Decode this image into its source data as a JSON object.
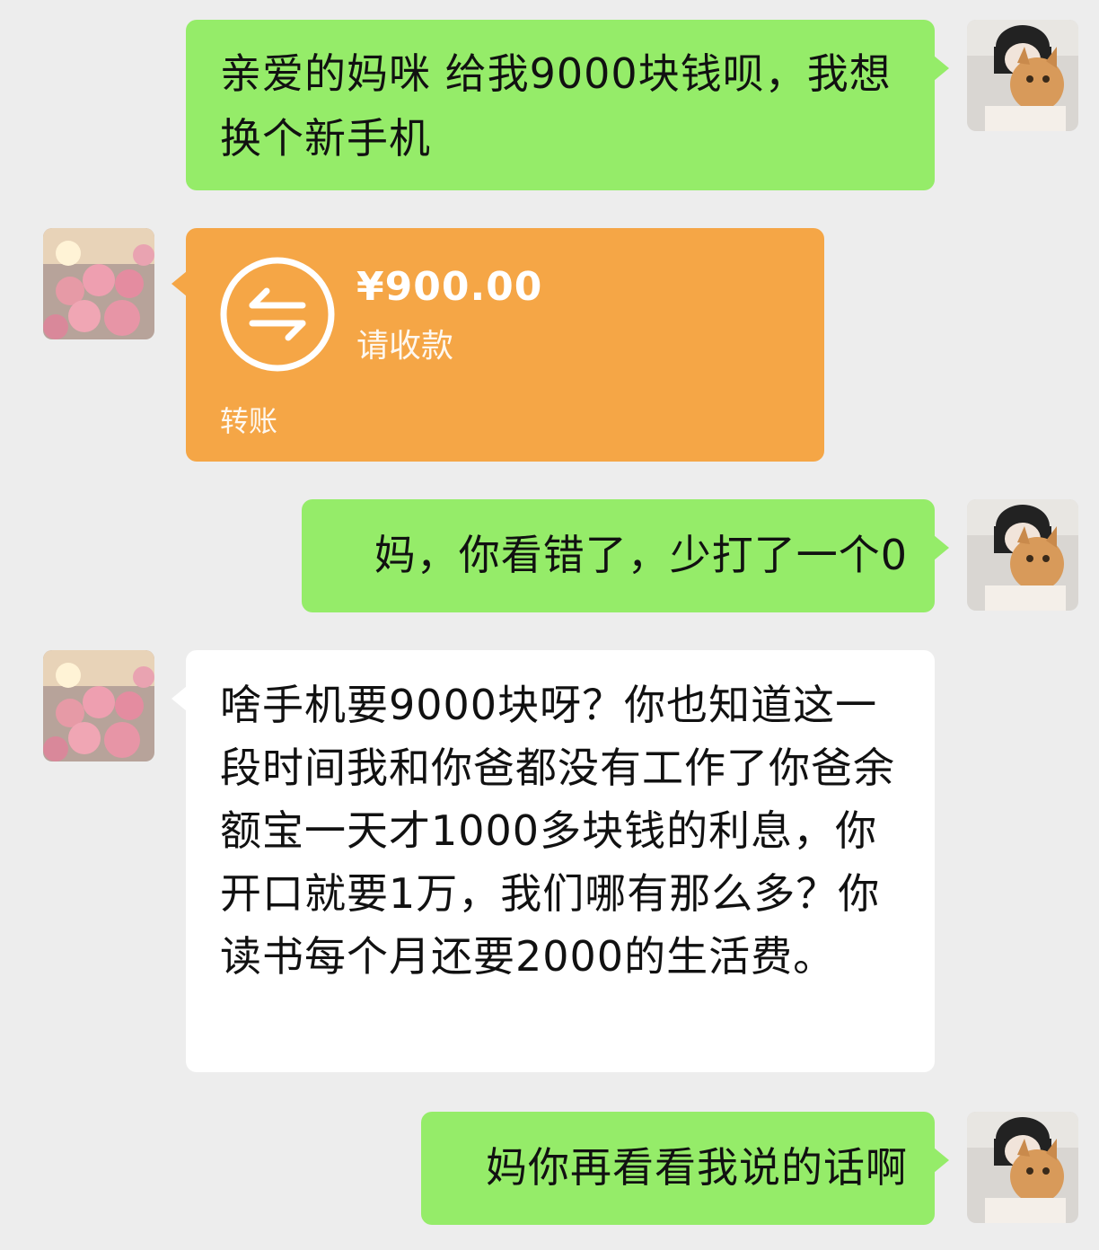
{
  "messages": [
    {
      "side": "right",
      "type": "text",
      "text": "亲爱的妈咪 给我9000块钱呗，我想换个新手机"
    },
    {
      "side": "left",
      "type": "transfer",
      "amount": "¥900.00",
      "status": "请收款",
      "label": "转账"
    },
    {
      "side": "right",
      "type": "text",
      "text": "妈，你看错了，少打了一个0"
    },
    {
      "side": "left",
      "type": "text",
      "text": "啥手机要9000块呀？你也知道这一段时间我和你爸都没有工作了你爸余额宝一天才1000多块钱的利息，你开口就要1万，我们哪有那么多？你读书每个月还要2000的生活费。"
    },
    {
      "side": "right",
      "type": "text",
      "text": "妈你再看看我说的话啊"
    }
  ],
  "colors": {
    "background": "#ededed",
    "sent_bubble": "#95ec69",
    "received_bubble": "#ffffff",
    "transfer_card": "#f5a646"
  },
  "icons": {
    "transfer": "transfer-arrows-icon",
    "avatar_self": "girl-with-cat-avatar",
    "avatar_mom": "pink-roses-avatar"
  }
}
